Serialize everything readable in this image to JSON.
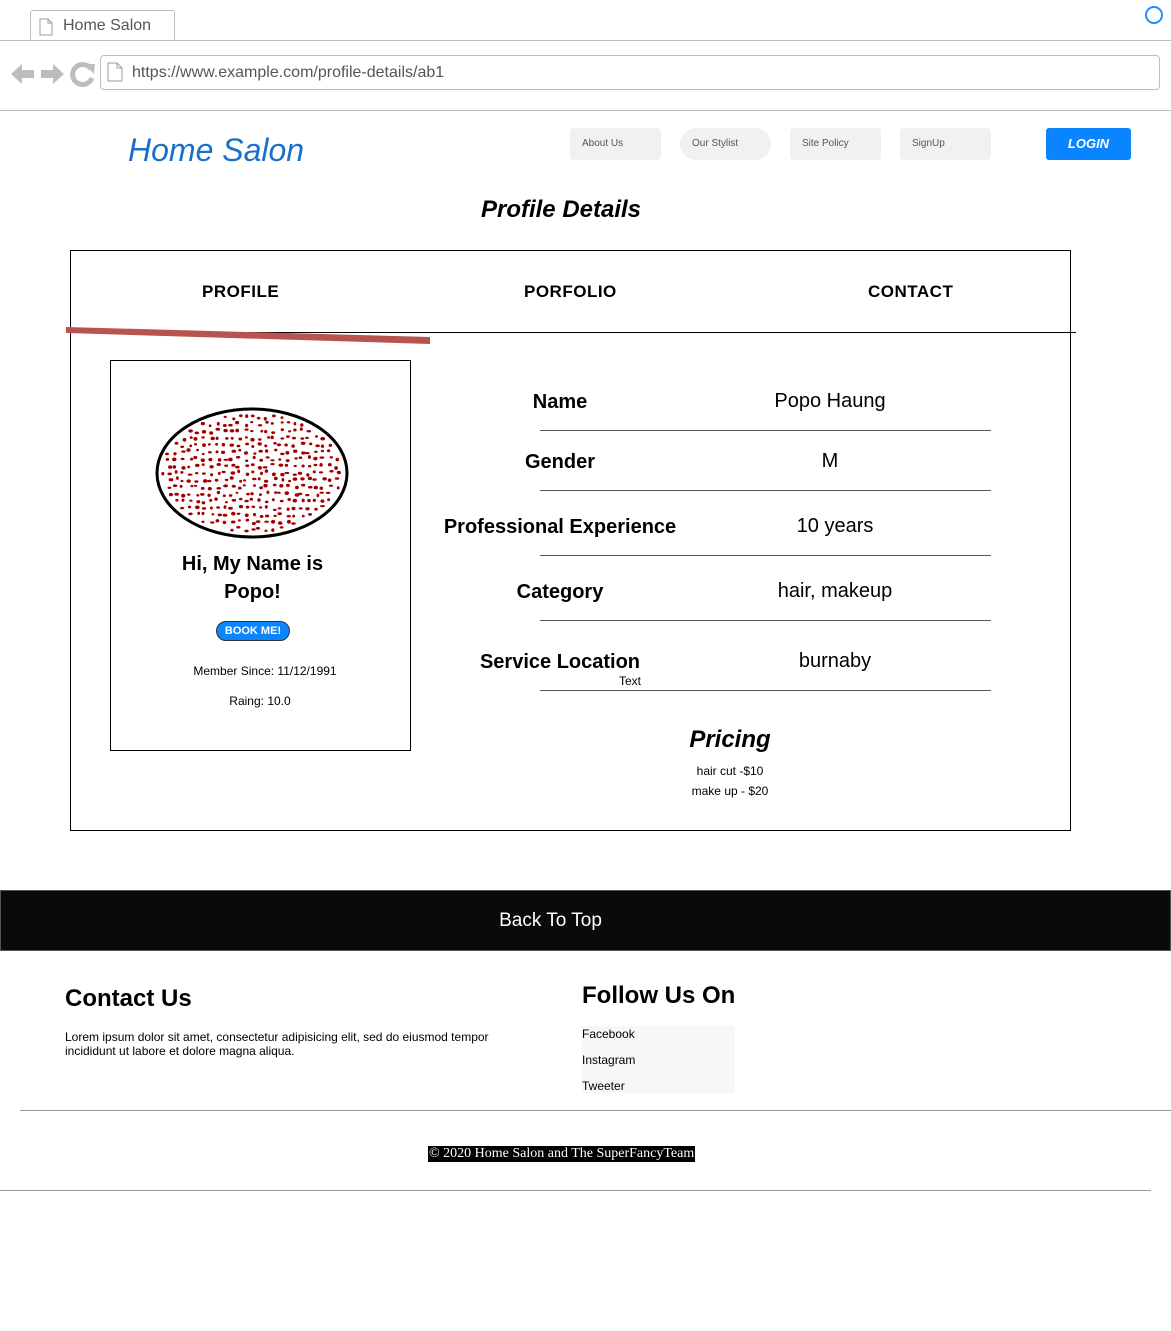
{
  "browser": {
    "tab_title": "Home Salon",
    "url": "https://www.example.com/profile-details/ab1"
  },
  "header": {
    "brand": "Home Salon",
    "nav": [
      "About Us",
      "Our Stylist",
      "Site Policy",
      "SignUp"
    ],
    "login_label": "LOGIN"
  },
  "page_title": "Profile Details",
  "tabs": [
    "PROFILE",
    "PORFOLIO",
    "CONTACT"
  ],
  "active_tab": "PROFILE",
  "card": {
    "greeting_line1": "Hi, My Name is",
    "greeting_line2": "Popo!",
    "book_label": "BOOK ME!",
    "member_since": "Member Since: 11/12/1991",
    "rating": "Raing: 10.0"
  },
  "details": {
    "name_label": "Name",
    "name_value": "Popo Haung",
    "gender_label": "Gender",
    "gender_value": "M",
    "experience_label": "Professional Experience",
    "experience_value": "10 years",
    "category_label": "Category",
    "category_value": "hair, makeup",
    "location_label": "Service Location",
    "location_value": "burnaby",
    "location_sub": "Text"
  },
  "pricing": {
    "title": "Pricing",
    "items": [
      "hair cut -$10",
      "make up - $20"
    ]
  },
  "back_to_top": "Back To Top",
  "footer": {
    "contact_title": "Contact Us",
    "contact_text": "Lorem ipsum dolor sit amet, consectetur adipisicing elit, sed do eiusmod tempor incididunt ut labore et dolore magna aliqua.",
    "follow_title": "Follow Us On",
    "social_links": [
      "Facebook",
      "Instagram",
      "Tweeter"
    ],
    "copyright": "© 2020 Home Salon and The SuperFancyTeam"
  },
  "colors": {
    "brand_blue": "#1a6fc9",
    "button_blue": "#0a84ff",
    "active_tab_underline": "#b85450",
    "avatar_dots": "#a30000"
  },
  "icons": [
    "document-icon",
    "back-arrow-icon",
    "forward-arrow-icon",
    "reload-icon",
    "circle-icon"
  ]
}
